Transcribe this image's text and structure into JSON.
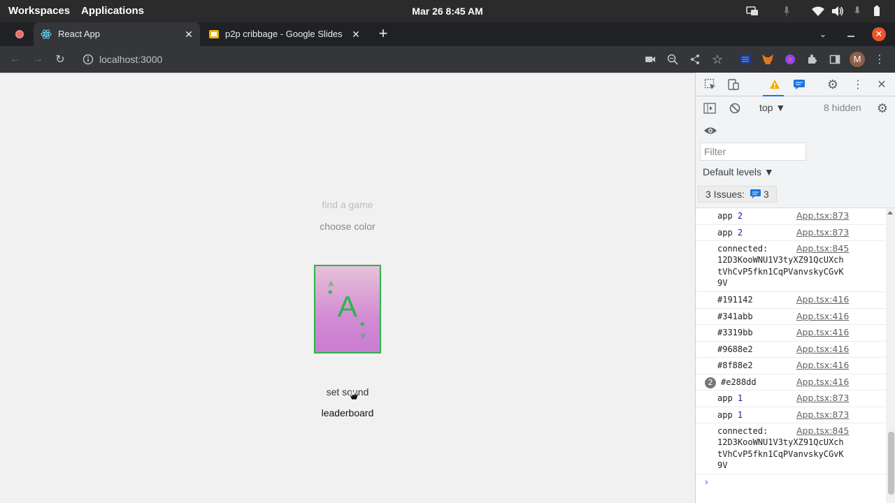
{
  "os": {
    "workspaces": "Workspaces",
    "applications": "Applications",
    "clock": "Mar 26   8:45 AM"
  },
  "tabs": [
    {
      "title": "React App",
      "icon": "react-icon"
    },
    {
      "title": "p2p cribbage - Google Slides",
      "icon": "slides-icon"
    }
  ],
  "toolbar": {
    "url": "localhost:3000",
    "profile_initial": "M"
  },
  "page": {
    "find_game": "find a game",
    "choose_color": "choose color",
    "set_sound": "set sound",
    "leaderboard": "leaderboard",
    "card": {
      "rank": "A",
      "suit": "♣",
      "color": "#2ab44a"
    }
  },
  "devtools": {
    "context": "top",
    "hidden": "8 hidden",
    "filter_placeholder": "Filter",
    "levels": "Default levels ▼",
    "issues_label": "3 Issues:",
    "issues_count": "3",
    "logs": [
      {
        "text": "app",
        "num": "2",
        "source": "App.tsx:873"
      },
      {
        "text": "app",
        "num": "2",
        "source": "App.tsx:873"
      },
      {
        "text": "connected:\n12D3KooWNU1V3tyXZ91QcUXch\ntVhCvP5fkn1CqPVanvskyCGvK\n9V",
        "num": "",
        "source": "App.tsx:845"
      },
      {
        "text": "#191142",
        "num": "",
        "source": "App.tsx:416"
      },
      {
        "text": "#341abb",
        "num": "",
        "source": "App.tsx:416"
      },
      {
        "text": "#3319bb",
        "num": "",
        "source": "App.tsx:416"
      },
      {
        "text": "#9688e2",
        "num": "",
        "source": "App.tsx:416"
      },
      {
        "text": "#8f88e2",
        "num": "",
        "source": "App.tsx:416"
      },
      {
        "text": "#e288dd",
        "num": "",
        "source": "App.tsx:416",
        "repeat": "2"
      },
      {
        "text": "app",
        "num": "1",
        "source": "App.tsx:873"
      },
      {
        "text": "app",
        "num": "1",
        "source": "App.tsx:873"
      },
      {
        "text": "connected:\n12D3KooWNU1V3tyXZ91QcUXch\ntVhCvP5fkn1CqPVanvskyCGvK\n9V",
        "num": "",
        "source": "App.tsx:845"
      }
    ]
  }
}
